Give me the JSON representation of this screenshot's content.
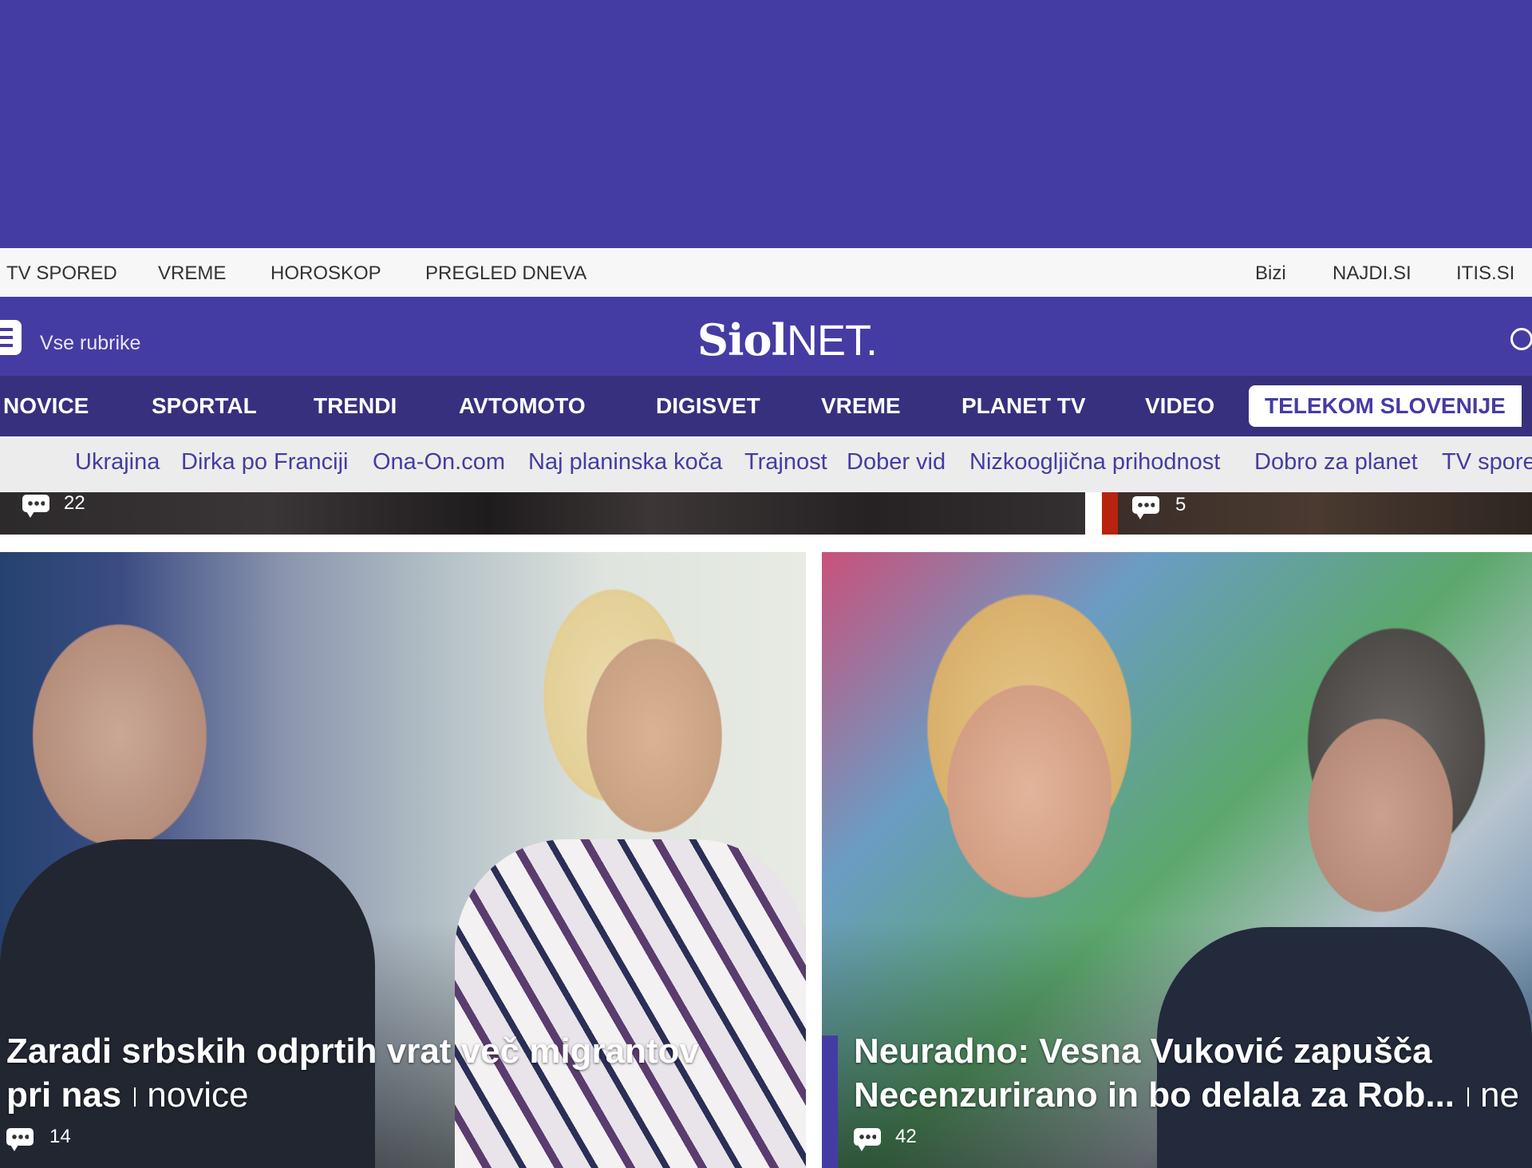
{
  "utility_nav": {
    "left": [
      "TV SPORED",
      "VREME",
      "HOROSKOP",
      "PREGLED DNEVA"
    ],
    "right": [
      "Bizi",
      "NAJDI.SI",
      "ITIS.SI"
    ]
  },
  "header": {
    "menu_label": "Vse rubrike",
    "logo_bold": "Siol",
    "logo_light": "NET."
  },
  "main_nav": {
    "items": [
      "NOVICE",
      "SPORTAL",
      "TRENDI",
      "AVTOMOTO",
      "DIGISVET",
      "VREME",
      "PLANET TV",
      "VIDEO",
      "TELEKOM SLOVENIJE"
    ]
  },
  "topics": [
    "Ukrajina",
    "Dirka po Franciji",
    "Ona-On.com",
    "Naj planinska koča",
    "Trajnost",
    "Dober vid",
    "Nizkoogljična prihodnost",
    "Dobro za planet",
    "TV spore"
  ],
  "strip": {
    "left_comments": "22",
    "right_comments": "5"
  },
  "articles": [
    {
      "title_line1": "Zaradi srbskih odprtih vrat več migrantov",
      "title_line2": "pri nas",
      "category": "novice",
      "comments": "14"
    },
    {
      "title_line1": "Neuradno: Vesna Vuković zapušča",
      "title_line2": "Necenzurirano in bo delala za Rob...",
      "category": "ne",
      "comments": "42"
    }
  ],
  "colors": {
    "brand": "#453ca3",
    "nav_dark": "#37307e",
    "topic_bg": "#ececec",
    "accent_red": "#b8230f"
  }
}
